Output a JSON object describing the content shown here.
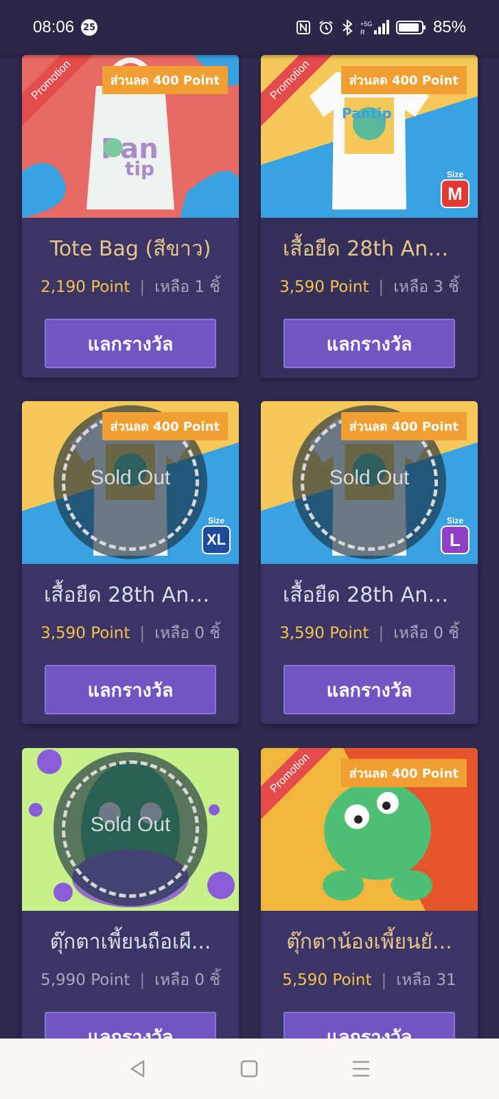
{
  "status_bar": {
    "time": "08:06",
    "notification_count": "25",
    "battery": "85%",
    "icons": [
      "nfc-icon",
      "alarm-icon",
      "bluetooth-icon",
      "signal-5g-icon",
      "battery-icon"
    ]
  },
  "cards": [
    {
      "title": "Tote Bag (สีขาว)",
      "points": "2,190 Point",
      "separator": "|",
      "stock": "เหลือ 1 ชิ้",
      "button": "แลกรางวัล",
      "promotion": "Promotion",
      "discount": "ส่วนลด 400 Point"
    },
    {
      "title": "เสื้อยืด 28th Ann...",
      "points": "3,590 Point",
      "separator": "|",
      "stock": "เหลือ 3 ชิ้",
      "button": "แลกรางวัล",
      "promotion": "Promotion",
      "discount": "ส่วนลด 400 Point",
      "size_caption": "Size",
      "size": "M"
    },
    {
      "title": "เสื้อยืด 28th Ann...",
      "points": "3,590 Point",
      "separator": "|",
      "stock": "เหลือ 0 ชิ้",
      "button": "แลกรางวัล",
      "discount": "ส่วนลด 400 Point",
      "sold_out": "Sold Out",
      "size_caption": "Size",
      "size": "XL"
    },
    {
      "title": "เสื้อยืด 28th Ann...",
      "points": "3,590 Point",
      "separator": "|",
      "stock": "เหลือ 0 ชิ้",
      "button": "แลกรางวัล",
      "discount": "ส่วนลด 400 Point",
      "sold_out": "Sold Out",
      "size_caption": "Size",
      "size": "L"
    },
    {
      "title": "ตุ๊กตาเพี้ยนถือเผื...",
      "points": "5,990 Point",
      "separator": "|",
      "stock": "เหลือ 0 ชิ้",
      "button": "แลกรางวัล",
      "sold_out": "Sold Out"
    },
    {
      "title": "ตุ๊กตาน้องเพี้ยนยั...",
      "points": "5,590 Point",
      "separator": "|",
      "stock": "เหลือ 31",
      "button": "แลกรางวัล",
      "promotion": "Promotion",
      "discount": "ส่วนลด 400 Point"
    }
  ],
  "colors": {
    "background": "#2e2a52",
    "card": "#3b3566",
    "button": "#7155c3",
    "points": "#f4c24d",
    "discount_tag": "#f0a030",
    "promo_ribbon": "#e44c4c",
    "size_m": "#e53935",
    "size_xl": "#1e4a9a",
    "size_l": "#8e3fc4"
  },
  "nav_bar": {
    "icons": [
      "back-icon",
      "home-icon",
      "menu-icon"
    ]
  }
}
